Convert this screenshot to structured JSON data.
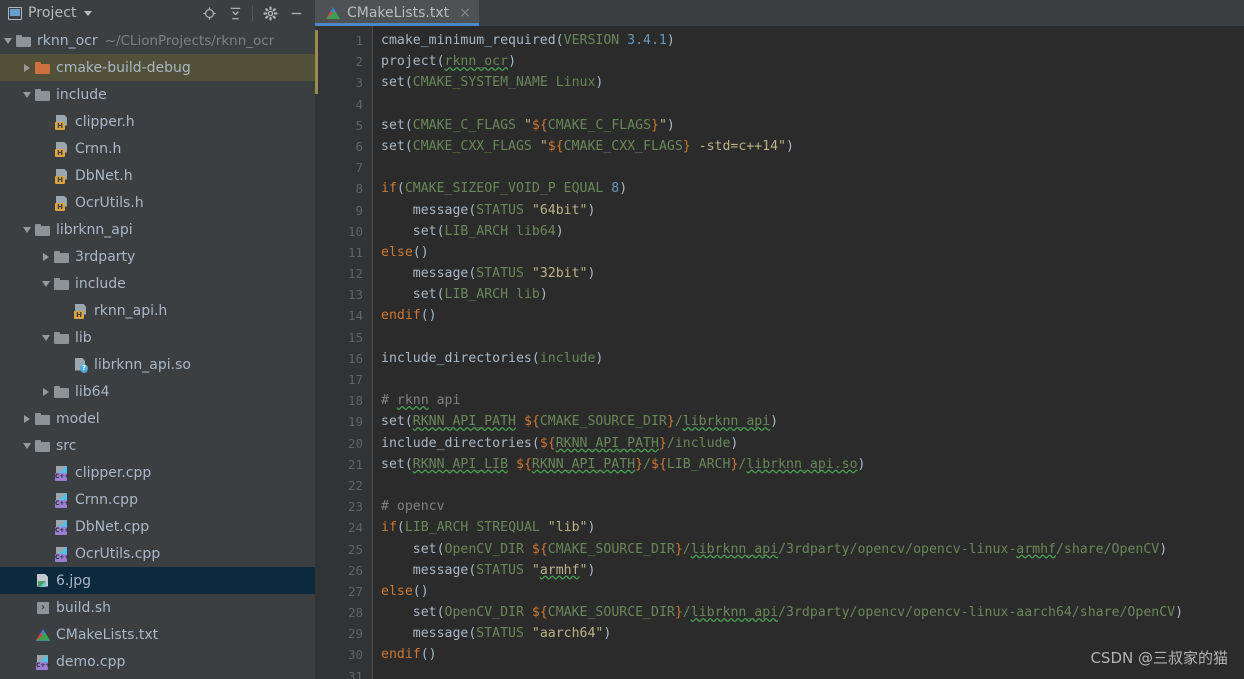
{
  "sidebar": {
    "panel_title": "Project",
    "panel_icon": "project-panel-icon",
    "tools": [
      {
        "name": "scroll-from-source-icon",
        "label": "Select Opened File"
      },
      {
        "name": "collapse-all-icon",
        "label": "Collapse All"
      },
      {
        "name": "gear-icon",
        "label": "Settings"
      },
      {
        "name": "minimize-icon",
        "label": "Hide"
      }
    ],
    "tree": [
      {
        "label": "rknn_ocr",
        "sub": "~/CLionProjects/rknn_ocr",
        "indent": 0,
        "arrow": "down",
        "icon": "folder",
        "state": "normal"
      },
      {
        "label": "cmake-build-debug",
        "sub": "",
        "indent": 1,
        "arrow": "right",
        "icon": "folder-orange",
        "state": "excluded"
      },
      {
        "label": "include",
        "sub": "",
        "indent": 1,
        "arrow": "down",
        "icon": "folder",
        "state": "normal"
      },
      {
        "label": "clipper.h",
        "sub": "",
        "indent": 2,
        "arrow": "none",
        "icon": "header",
        "state": "normal"
      },
      {
        "label": "Crnn.h",
        "sub": "",
        "indent": 2,
        "arrow": "none",
        "icon": "header",
        "state": "normal"
      },
      {
        "label": "DbNet.h",
        "sub": "",
        "indent": 2,
        "arrow": "none",
        "icon": "header",
        "state": "normal"
      },
      {
        "label": "OcrUtils.h",
        "sub": "",
        "indent": 2,
        "arrow": "none",
        "icon": "header",
        "state": "normal"
      },
      {
        "label": "librknn_api",
        "sub": "",
        "indent": 1,
        "arrow": "down",
        "icon": "folder",
        "state": "normal"
      },
      {
        "label": "3rdparty",
        "sub": "",
        "indent": 2,
        "arrow": "right",
        "icon": "folder",
        "state": "normal"
      },
      {
        "label": "include",
        "sub": "",
        "indent": 2,
        "arrow": "down",
        "icon": "folder",
        "state": "normal"
      },
      {
        "label": "rknn_api.h",
        "sub": "",
        "indent": 3,
        "arrow": "none",
        "icon": "header",
        "state": "normal"
      },
      {
        "label": "lib",
        "sub": "",
        "indent": 2,
        "arrow": "down",
        "icon": "folder",
        "state": "normal"
      },
      {
        "label": "librknn_api.so",
        "sub": "",
        "indent": 3,
        "arrow": "none",
        "icon": "so",
        "state": "normal"
      },
      {
        "label": "lib64",
        "sub": "",
        "indent": 2,
        "arrow": "right",
        "icon": "folder",
        "state": "normal"
      },
      {
        "label": "model",
        "sub": "",
        "indent": 1,
        "arrow": "right",
        "icon": "folder",
        "state": "normal"
      },
      {
        "label": "src",
        "sub": "",
        "indent": 1,
        "arrow": "down",
        "icon": "folder",
        "state": "normal"
      },
      {
        "label": "clipper.cpp",
        "sub": "",
        "indent": 2,
        "arrow": "none",
        "icon": "cpp",
        "state": "normal"
      },
      {
        "label": "Crnn.cpp",
        "sub": "",
        "indent": 2,
        "arrow": "none",
        "icon": "cpp",
        "state": "normal"
      },
      {
        "label": "DbNet.cpp",
        "sub": "",
        "indent": 2,
        "arrow": "none",
        "icon": "cpp",
        "state": "normal"
      },
      {
        "label": "OcrUtils.cpp",
        "sub": "",
        "indent": 2,
        "arrow": "none",
        "icon": "cpp",
        "state": "normal"
      },
      {
        "label": "6.jpg",
        "sub": "",
        "indent": 1,
        "arrow": "none",
        "icon": "image",
        "state": "selected"
      },
      {
        "label": "build.sh",
        "sub": "",
        "indent": 1,
        "arrow": "none",
        "icon": "shell",
        "state": "normal"
      },
      {
        "label": "CMakeLists.txt",
        "sub": "",
        "indent": 1,
        "arrow": "none",
        "icon": "cmake",
        "state": "normal"
      },
      {
        "label": "demo.cpp",
        "sub": "",
        "indent": 1,
        "arrow": "none",
        "icon": "cpp",
        "state": "normal"
      }
    ]
  },
  "editor": {
    "tabs": [
      {
        "label": "CMakeLists.txt",
        "icon": "cmake-file-icon",
        "close": "×",
        "active": true
      }
    ],
    "first_line": 1,
    "last_line": 31,
    "lines": [
      {
        "n": 1,
        "tokens": [
          {
            "t": "cmake_minimum_required",
            "c": "cmd"
          },
          {
            "t": "(",
            "c": "cl"
          },
          {
            "t": "VERSION",
            "c": "arg"
          },
          {
            "t": " ",
            "c": "cl"
          },
          {
            "t": "3.4.1",
            "c": "num"
          },
          {
            "t": ")",
            "c": "cl"
          }
        ]
      },
      {
        "n": 2,
        "tokens": [
          {
            "t": "project",
            "c": "cmd"
          },
          {
            "t": "(",
            "c": "cl"
          },
          {
            "t": "rknn_ocr",
            "c": "arg typo"
          },
          {
            "t": ")",
            "c": "cl"
          }
        ]
      },
      {
        "n": 3,
        "tokens": [
          {
            "t": "set",
            "c": "cmd"
          },
          {
            "t": "(",
            "c": "cl"
          },
          {
            "t": "CMAKE_SYSTEM_NAME",
            "c": "arg"
          },
          {
            "t": " Linux",
            "c": "arg"
          },
          {
            "t": ")",
            "c": "cl"
          }
        ]
      },
      {
        "n": 4,
        "tokens": []
      },
      {
        "n": 5,
        "tokens": [
          {
            "t": "set",
            "c": "cmd"
          },
          {
            "t": "(",
            "c": "cl"
          },
          {
            "t": "CMAKE_C_FLAGS",
            "c": "arg"
          },
          {
            "t": " ",
            "c": "cl"
          },
          {
            "t": "\"",
            "c": "str"
          },
          {
            "t": "${",
            "c": "var"
          },
          {
            "t": "CMAKE_C_FLAGS",
            "c": "arg"
          },
          {
            "t": "}",
            "c": "var"
          },
          {
            "t": "\"",
            "c": "str"
          },
          {
            "t": ")",
            "c": "cl"
          }
        ]
      },
      {
        "n": 6,
        "tokens": [
          {
            "t": "set",
            "c": "cmd"
          },
          {
            "t": "(",
            "c": "cl"
          },
          {
            "t": "CMAKE_CXX_FLAGS",
            "c": "arg"
          },
          {
            "t": " ",
            "c": "cl"
          },
          {
            "t": "\"",
            "c": "str"
          },
          {
            "t": "${",
            "c": "var"
          },
          {
            "t": "CMAKE_CXX_FLAGS",
            "c": "arg"
          },
          {
            "t": "}",
            "c": "var"
          },
          {
            "t": " -std=c++14\"",
            "c": "str"
          },
          {
            "t": ")",
            "c": "cl"
          }
        ]
      },
      {
        "n": 7,
        "tokens": []
      },
      {
        "n": 8,
        "tokens": [
          {
            "t": "if",
            "c": "kw"
          },
          {
            "t": "(",
            "c": "cl"
          },
          {
            "t": "CMAKE_SIZEOF_VOID_P",
            "c": "arg"
          },
          {
            "t": " EQUAL",
            "c": "arg"
          },
          {
            "t": " ",
            "c": "cl"
          },
          {
            "t": "8",
            "c": "num"
          },
          {
            "t": ")",
            "c": "cl"
          }
        ]
      },
      {
        "n": 9,
        "tokens": [
          {
            "t": "    ",
            "c": "cl"
          },
          {
            "t": "message",
            "c": "cmd"
          },
          {
            "t": "(",
            "c": "cl"
          },
          {
            "t": "STATUS",
            "c": "arg"
          },
          {
            "t": " ",
            "c": "cl"
          },
          {
            "t": "\"64bit\"",
            "c": "str"
          },
          {
            "t": ")",
            "c": "cl"
          }
        ]
      },
      {
        "n": 10,
        "tokens": [
          {
            "t": "    ",
            "c": "cl"
          },
          {
            "t": "set",
            "c": "cmd"
          },
          {
            "t": "(",
            "c": "cl"
          },
          {
            "t": "LIB_ARCH",
            "c": "arg"
          },
          {
            "t": " lib64",
            "c": "arg"
          },
          {
            "t": ")",
            "c": "cl"
          }
        ]
      },
      {
        "n": 11,
        "tokens": [
          {
            "t": "else",
            "c": "kw"
          },
          {
            "t": "()",
            "c": "cl"
          }
        ]
      },
      {
        "n": 12,
        "tokens": [
          {
            "t": "    ",
            "c": "cl"
          },
          {
            "t": "message",
            "c": "cmd"
          },
          {
            "t": "(",
            "c": "cl"
          },
          {
            "t": "STATUS",
            "c": "arg"
          },
          {
            "t": " ",
            "c": "cl"
          },
          {
            "t": "\"32bit\"",
            "c": "str"
          },
          {
            "t": ")",
            "c": "cl"
          }
        ]
      },
      {
        "n": 13,
        "tokens": [
          {
            "t": "    ",
            "c": "cl"
          },
          {
            "t": "set",
            "c": "cmd"
          },
          {
            "t": "(",
            "c": "cl"
          },
          {
            "t": "LIB_ARCH",
            "c": "arg"
          },
          {
            "t": " lib",
            "c": "arg"
          },
          {
            "t": ")",
            "c": "cl"
          }
        ]
      },
      {
        "n": 14,
        "tokens": [
          {
            "t": "endif",
            "c": "kw"
          },
          {
            "t": "()",
            "c": "cl"
          }
        ]
      },
      {
        "n": 15,
        "tokens": []
      },
      {
        "n": 16,
        "tokens": [
          {
            "t": "include_directories",
            "c": "cmd"
          },
          {
            "t": "(",
            "c": "cl"
          },
          {
            "t": "include",
            "c": "arg"
          },
          {
            "t": ")",
            "c": "cl"
          }
        ]
      },
      {
        "n": 17,
        "tokens": []
      },
      {
        "n": 18,
        "tokens": [
          {
            "t": "# ",
            "c": "com"
          },
          {
            "t": "rknn",
            "c": "com typo"
          },
          {
            "t": " api",
            "c": "com"
          }
        ]
      },
      {
        "n": 19,
        "tokens": [
          {
            "t": "set",
            "c": "cmd"
          },
          {
            "t": "(",
            "c": "cl"
          },
          {
            "t": "RKNN_API_PATH",
            "c": "arg typo"
          },
          {
            "t": " ",
            "c": "cl"
          },
          {
            "t": "${",
            "c": "var"
          },
          {
            "t": "CMAKE_SOURCE_DIR",
            "c": "arg"
          },
          {
            "t": "}",
            "c": "var"
          },
          {
            "t": "/",
            "c": "path"
          },
          {
            "t": "librknn_api",
            "c": "path typo"
          },
          {
            "t": ")",
            "c": "cl"
          }
        ]
      },
      {
        "n": 20,
        "tokens": [
          {
            "t": "include_directories",
            "c": "cmd"
          },
          {
            "t": "(",
            "c": "cl"
          },
          {
            "t": "${",
            "c": "var"
          },
          {
            "t": "RKNN_API_PATH",
            "c": "arg typo"
          },
          {
            "t": "}",
            "c": "var"
          },
          {
            "t": "/include",
            "c": "path"
          },
          {
            "t": ")",
            "c": "cl"
          }
        ]
      },
      {
        "n": 21,
        "tokens": [
          {
            "t": "set",
            "c": "cmd"
          },
          {
            "t": "(",
            "c": "cl"
          },
          {
            "t": "RKNN_API_LIB",
            "c": "arg typo"
          },
          {
            "t": " ",
            "c": "cl"
          },
          {
            "t": "${",
            "c": "var"
          },
          {
            "t": "RKNN_API_PATH",
            "c": "arg typo"
          },
          {
            "t": "}",
            "c": "var"
          },
          {
            "t": "/",
            "c": "path"
          },
          {
            "t": "${",
            "c": "var"
          },
          {
            "t": "LIB_ARCH",
            "c": "arg"
          },
          {
            "t": "}",
            "c": "var"
          },
          {
            "t": "/",
            "c": "path"
          },
          {
            "t": "librknn_api.so",
            "c": "path typo"
          },
          {
            "t": ")",
            "c": "cl"
          }
        ]
      },
      {
        "n": 22,
        "tokens": []
      },
      {
        "n": 23,
        "tokens": [
          {
            "t": "# opencv",
            "c": "com"
          }
        ]
      },
      {
        "n": 24,
        "tokens": [
          {
            "t": "if",
            "c": "kw"
          },
          {
            "t": "(",
            "c": "cl"
          },
          {
            "t": "LIB_ARCH",
            "c": "arg"
          },
          {
            "t": " STREQUAL",
            "c": "arg"
          },
          {
            "t": " ",
            "c": "cl"
          },
          {
            "t": "\"lib\"",
            "c": "str"
          },
          {
            "t": ")",
            "c": "cl"
          }
        ]
      },
      {
        "n": 25,
        "tokens": [
          {
            "t": "    ",
            "c": "cl"
          },
          {
            "t": "set",
            "c": "cmd"
          },
          {
            "t": "(",
            "c": "cl"
          },
          {
            "t": "OpenCV_DIR",
            "c": "arg"
          },
          {
            "t": " ",
            "c": "cl"
          },
          {
            "t": "${",
            "c": "var"
          },
          {
            "t": "CMAKE_SOURCE_DIR",
            "c": "arg"
          },
          {
            "t": "}",
            "c": "var"
          },
          {
            "t": "/",
            "c": "path"
          },
          {
            "t": "librknn_api",
            "c": "path typo"
          },
          {
            "t": "/3rdparty/opencv/opencv-linux-",
            "c": "path"
          },
          {
            "t": "armhf",
            "c": "path typo"
          },
          {
            "t": "/share/OpenCV",
            "c": "path"
          },
          {
            "t": ")",
            "c": "cl"
          }
        ]
      },
      {
        "n": 26,
        "tokens": [
          {
            "t": "    ",
            "c": "cl"
          },
          {
            "t": "message",
            "c": "cmd"
          },
          {
            "t": "(",
            "c": "cl"
          },
          {
            "t": "STATUS",
            "c": "arg"
          },
          {
            "t": " ",
            "c": "cl"
          },
          {
            "t": "\"",
            "c": "str"
          },
          {
            "t": "armhf",
            "c": "str typo"
          },
          {
            "t": "\"",
            "c": "str"
          },
          {
            "t": ")",
            "c": "cl"
          }
        ]
      },
      {
        "n": 27,
        "tokens": [
          {
            "t": "else",
            "c": "kw"
          },
          {
            "t": "()",
            "c": "cl"
          }
        ]
      },
      {
        "n": 28,
        "tokens": [
          {
            "t": "    ",
            "c": "cl"
          },
          {
            "t": "set",
            "c": "cmd"
          },
          {
            "t": "(",
            "c": "cl"
          },
          {
            "t": "OpenCV_DIR",
            "c": "arg"
          },
          {
            "t": " ",
            "c": "cl"
          },
          {
            "t": "${",
            "c": "var"
          },
          {
            "t": "CMAKE_SOURCE_DIR",
            "c": "arg"
          },
          {
            "t": "}",
            "c": "var"
          },
          {
            "t": "/",
            "c": "path"
          },
          {
            "t": "librknn_api",
            "c": "path typo"
          },
          {
            "t": "/3rdparty/opencv/opencv-linux-aarch64/share/OpenCV",
            "c": "path"
          },
          {
            "t": ")",
            "c": "cl"
          }
        ]
      },
      {
        "n": 29,
        "tokens": [
          {
            "t": "    ",
            "c": "cl"
          },
          {
            "t": "message",
            "c": "cmd"
          },
          {
            "t": "(",
            "c": "cl"
          },
          {
            "t": "STATUS",
            "c": "arg"
          },
          {
            "t": " ",
            "c": "cl"
          },
          {
            "t": "\"aarch64\"",
            "c": "str"
          },
          {
            "t": ")",
            "c": "cl"
          }
        ]
      },
      {
        "n": 30,
        "tokens": [
          {
            "t": "endif",
            "c": "kw"
          },
          {
            "t": "()",
            "c": "cl"
          }
        ]
      },
      {
        "n": 31,
        "tokens": []
      }
    ]
  },
  "watermark": {
    "text": "CSDN @三叔家的猫"
  },
  "colors": {
    "sidebar_bg": "#3c3f41",
    "editor_bg": "#2b2b2b",
    "gutter_bg": "#313335",
    "selection": "#0d293e",
    "excluded": "#53503a",
    "tab_active": "#4e5254",
    "tab_underline": "#4a88c7",
    "keyword": "#cc7832",
    "argument": "#6a8759",
    "string": "#b9b387",
    "number": "#6897bb",
    "comment": "#808080",
    "text": "#a9b7c6"
  }
}
